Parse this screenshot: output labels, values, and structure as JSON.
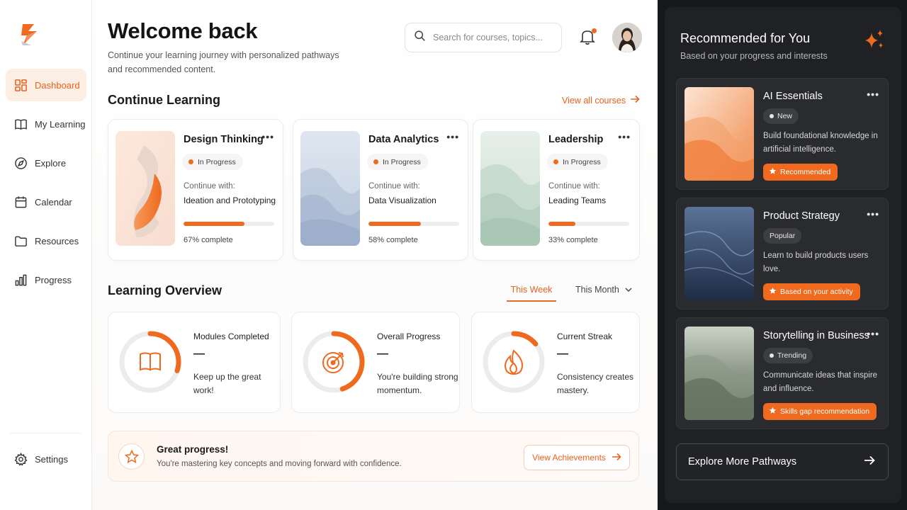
{
  "colors": {
    "accent": "#ef6a1f",
    "accent_text": "#e8621c",
    "dark_panel": "#202124",
    "card_dark": "#2a2b2e"
  },
  "sidebar": {
    "items": [
      {
        "label": "Dashboard",
        "icon": "grid-icon",
        "active": true
      },
      {
        "label": "My Learning",
        "icon": "book-icon"
      },
      {
        "label": "Explore",
        "icon": "compass-icon"
      },
      {
        "label": "Calendar",
        "icon": "calendar-icon"
      },
      {
        "label": "Resources",
        "icon": "folder-icon"
      },
      {
        "label": "Progress",
        "icon": "bar-chart-icon"
      }
    ],
    "settings_label": "Settings"
  },
  "header": {
    "title": "Welcome back",
    "subtitle": "Continue your learning journey with personalized pathways and recommended content.",
    "search_placeholder": "Search for courses, topics..."
  },
  "continue": {
    "title": "Continue Learning",
    "view_all": "View all courses",
    "courses": [
      {
        "name": "Design Thinking",
        "status": "In Progress",
        "continue_label": "Continue with:",
        "next": "Ideation and Prototyping",
        "progress": 0.67,
        "progress_label": "67% complete"
      },
      {
        "name": "Data Analytics",
        "status": "In Progress",
        "continue_label": "Continue with:",
        "next": "Data Visualization",
        "progress": 0.58,
        "progress_label": "58% complete"
      },
      {
        "name": "Leadership",
        "status": "In Progress",
        "continue_label": "Continue with:",
        "next": "Leading Teams",
        "progress": 0.33,
        "progress_label": "33% complete"
      }
    ]
  },
  "overview": {
    "title": "Learning Overview",
    "tab_week": "This Week",
    "tab_month": "This Month",
    "stats": [
      {
        "title": "Modules Completed",
        "value": "—",
        "desc": "Keep up the great work!",
        "icon": "open-book-icon",
        "ring": 0.3
      },
      {
        "title": "Overall Progress",
        "value": "—",
        "desc": "You're building strong momentum.",
        "icon": "target-icon",
        "ring": 0.45
      },
      {
        "title": "Current Streak",
        "value": "—",
        "desc": "Consistency creates mastery.",
        "icon": "flame-icon",
        "ring": 0.14
      }
    ]
  },
  "banner": {
    "title": "Great progress!",
    "subtitle": "You're mastering key concepts and moving forward with confidence.",
    "button": "View Achievements"
  },
  "recommended": {
    "title": "Recommended for You",
    "subtitle": "Based on your progress and interests",
    "items": [
      {
        "name": "AI Essentials",
        "tag": "New",
        "desc": "Build foundational knowledge in artificial intelligence.",
        "badge": "Recommended"
      },
      {
        "name": "Product Strategy",
        "tag": "Popular",
        "desc": "Learn to build products users love.",
        "badge": "Based on your activity"
      },
      {
        "name": "Storytelling in Business",
        "tag": "Trending",
        "desc": "Communicate ideas that inspire and influence.",
        "badge": "Skills gap recommendation"
      }
    ],
    "explore_button": "Explore More Pathways"
  }
}
